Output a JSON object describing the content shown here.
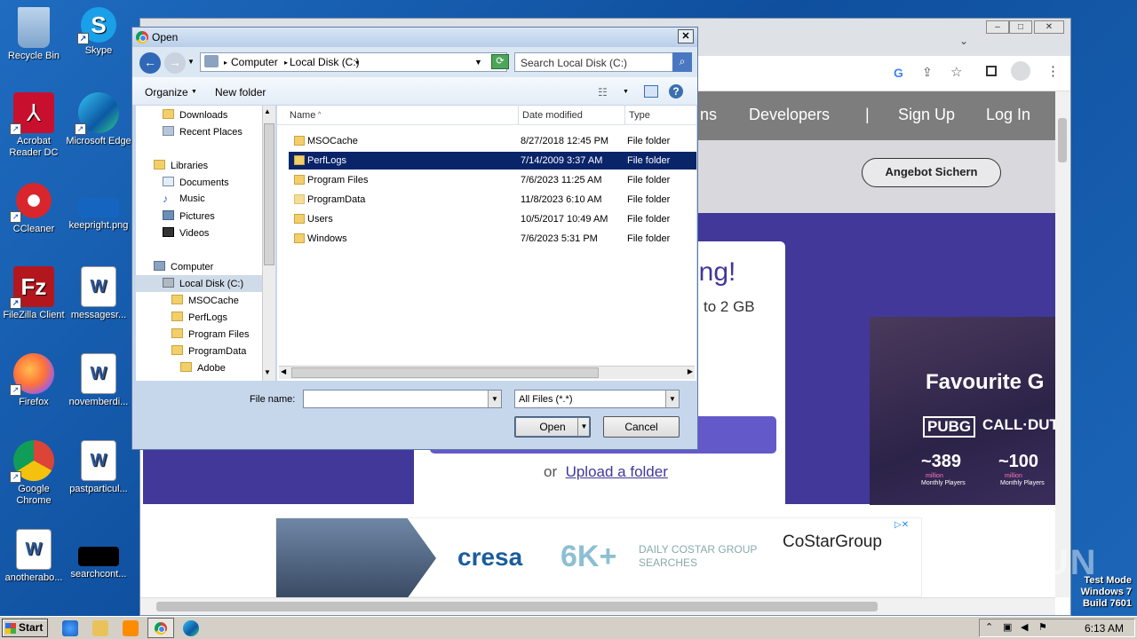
{
  "desktop": {
    "icons": [
      {
        "label": "Recycle Bin"
      },
      {
        "label": "Skype"
      },
      {
        "label": "Acrobat Reader DC"
      },
      {
        "label": "Microsoft Edge"
      },
      {
        "label": "CCleaner"
      },
      {
        "label": "keepright.png"
      },
      {
        "label": "FileZilla Client"
      },
      {
        "label": "messagesr..."
      },
      {
        "label": "Firefox"
      },
      {
        "label": "novemberdi..."
      },
      {
        "label": "Google Chrome"
      },
      {
        "label": "pastparticul..."
      },
      {
        "label": "anotherabo..."
      },
      {
        "label": "searchcont..."
      }
    ]
  },
  "browser": {
    "nav": [
      "ns",
      "Developers",
      "|",
      "Sign Up",
      "Log In"
    ],
    "angebot": "Angebot Sichern",
    "card_big": "ring!",
    "card_sub": "to 2 GB",
    "card_or": "or",
    "card_link": "Upload a folder",
    "ad_side": {
      "title": "Favourite G",
      "game1": "PUBG",
      "game2": "CALL·DUTY",
      "num1": "~389",
      "num2": "~100",
      "unit": "million",
      "unit_sub": "Monthly Players"
    },
    "ad_bottom": {
      "brand": "cresa",
      "big": "6K+",
      "text": "DAILY COSTAR GROUP SEARCHES",
      "sponsor": "CoStarGroup"
    }
  },
  "dialog": {
    "title": "Open",
    "path": [
      "Computer",
      "Local Disk (C:)"
    ],
    "search_placeholder": "Search Local Disk (C:)",
    "toolbar": {
      "organize": "Organize",
      "new_folder": "New folder"
    },
    "tree": [
      {
        "label": "Downloads"
      },
      {
        "label": "Recent Places"
      },
      {
        "label": "Libraries"
      },
      {
        "label": "Documents"
      },
      {
        "label": "Music"
      },
      {
        "label": "Pictures"
      },
      {
        "label": "Videos"
      },
      {
        "label": "Computer"
      },
      {
        "label": "Local Disk (C:)"
      },
      {
        "label": "MSOCache"
      },
      {
        "label": "PerfLogs"
      },
      {
        "label": "Program Files"
      },
      {
        "label": "ProgramData"
      },
      {
        "label": "Adobe"
      }
    ],
    "columns": {
      "name": "Name",
      "date": "Date modified",
      "type": "Type"
    },
    "rows": [
      {
        "name": "MSOCache",
        "date": "8/27/2018 12:45 PM",
        "type": "File folder"
      },
      {
        "name": "PerfLogs",
        "date": "7/14/2009 3:37 AM",
        "type": "File folder"
      },
      {
        "name": "Program Files",
        "date": "7/6/2023 11:25 AM",
        "type": "File folder"
      },
      {
        "name": "ProgramData",
        "date": "11/8/2023 6:10 AM",
        "type": "File folder"
      },
      {
        "name": "Users",
        "date": "10/5/2017 10:49 AM",
        "type": "File folder"
      },
      {
        "name": "Windows",
        "date": "7/6/2023 5:31 PM",
        "type": "File folder"
      }
    ],
    "file_name_label": "File name:",
    "file_name_value": "",
    "filter": "All Files (*.*)",
    "open": "Open",
    "cancel": "Cancel"
  },
  "taskbar": {
    "start": "Start",
    "clock": "6:13 AM"
  },
  "watermark": {
    "line1": "Test Mode",
    "line2": "Windows 7",
    "line3": "Build 7601",
    "anyrun": "ANY RUN"
  },
  "colors": {
    "selection": "#0a246a",
    "site_purple": "#41389a",
    "button_purple": "#6459c9"
  }
}
